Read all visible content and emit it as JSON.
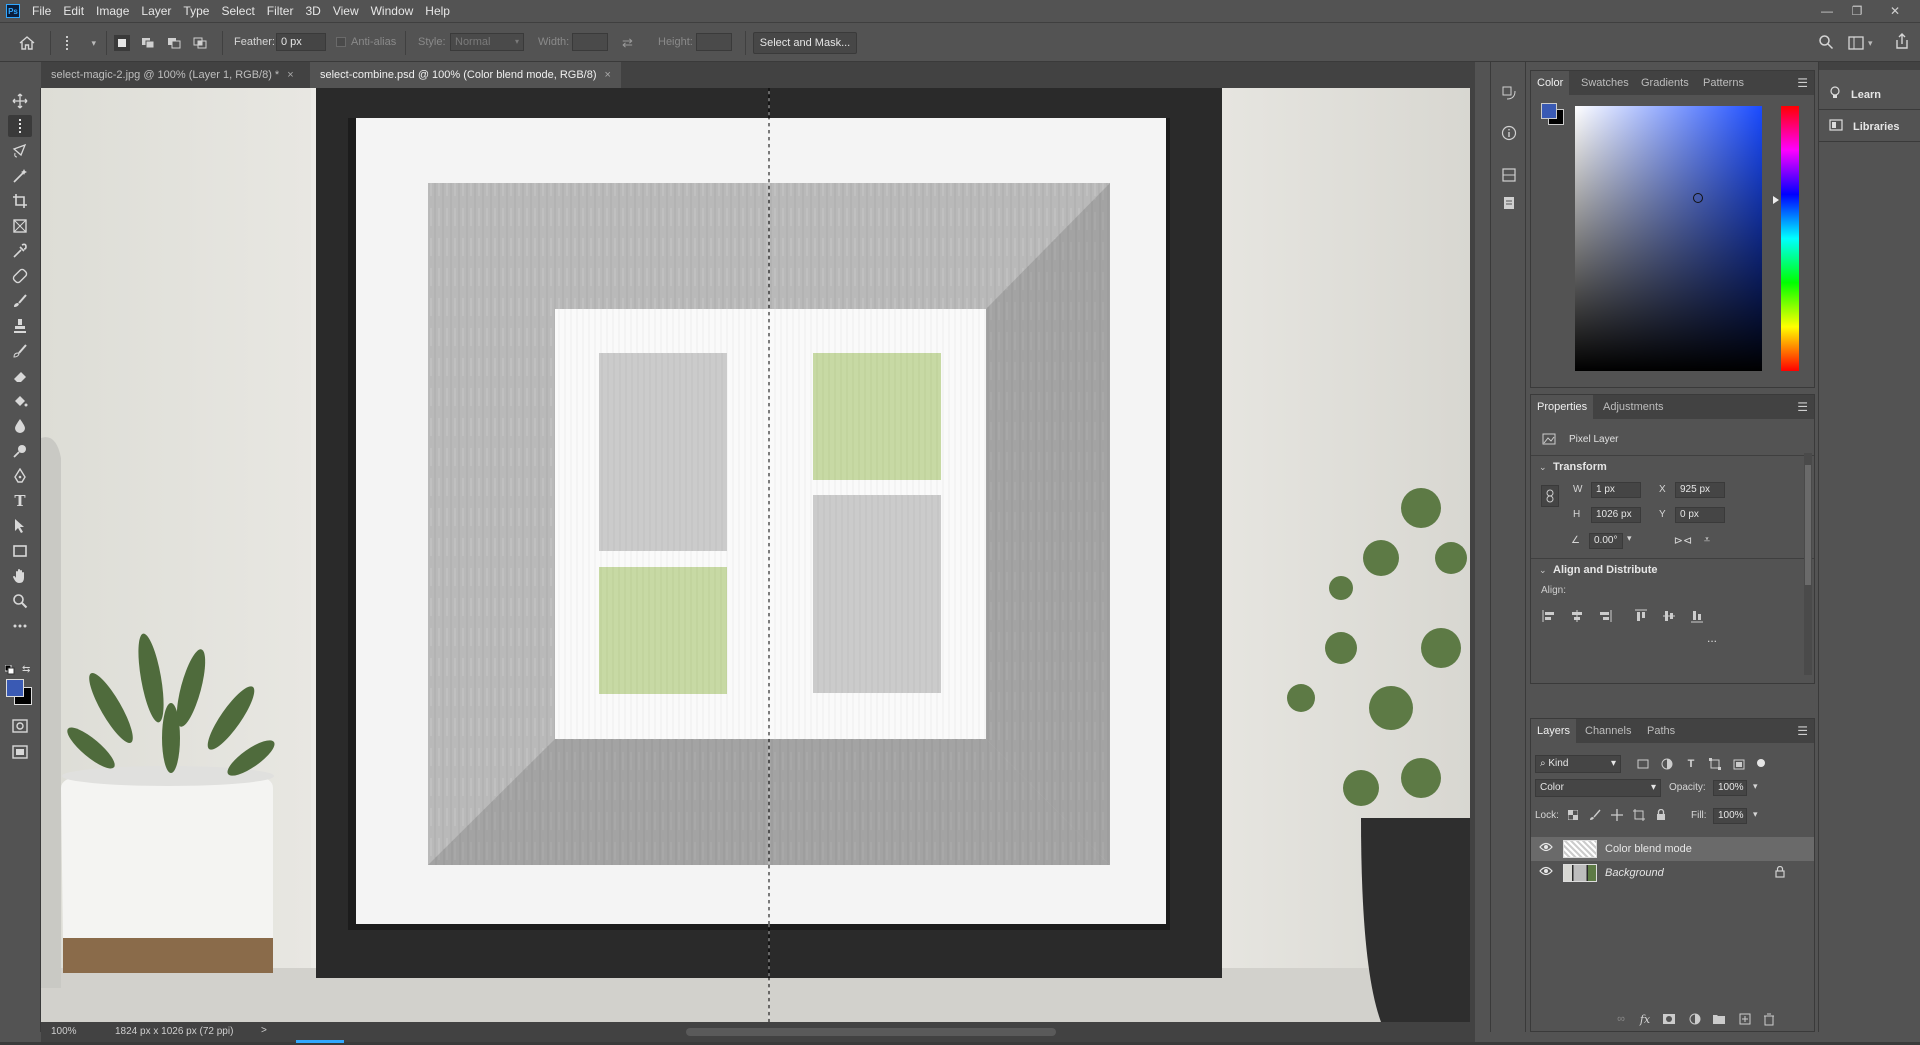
{
  "menubar": {
    "items": [
      "File",
      "Edit",
      "Image",
      "Layer",
      "Type",
      "Select",
      "Filter",
      "3D",
      "View",
      "Window",
      "Help"
    ],
    "app_icon_label": "Ps"
  },
  "options": {
    "feather_label": "Feather:",
    "feather_value": "0 px",
    "antialias_label": "Anti-alias",
    "style_label": "Style:",
    "style_value": "Normal",
    "width_label": "Width:",
    "height_label": "Height:",
    "select_mask_label": "Select and Mask..."
  },
  "tabs": [
    {
      "label": "select-magic-2.jpg @ 100% (Layer 1, RGB/8) *",
      "close": "×"
    },
    {
      "label": "select-combine.psd @ 100% (Color blend mode, RGB/8)",
      "close": "×"
    }
  ],
  "status": {
    "zoom": "100%",
    "doc_size": "1824 px x 1026 px (72 ppi)",
    "arrow": ">"
  },
  "color_panel": {
    "tabs": [
      "Color",
      "Swatches",
      "Gradients",
      "Patterns"
    ],
    "foreground": "#3a5ab4",
    "background": "#000000"
  },
  "properties_panel": {
    "tabs": [
      "Properties",
      "Adjustments"
    ],
    "layer_type": "Pixel Layer",
    "transform_title": "Transform",
    "w_label": "W",
    "w_value": "1 px",
    "x_label": "X",
    "x_value": "925 px",
    "h_label": "H",
    "h_value": "1026 px",
    "y_label": "Y",
    "y_value": "0 px",
    "angle_value": "0.00°",
    "align_title": "Align and Distribute",
    "align_label": "Align:",
    "more": "..."
  },
  "layers_panel": {
    "tabs": [
      "Layers",
      "Channels",
      "Paths"
    ],
    "kind_label": "Kind",
    "blend_mode": "Color",
    "opacity_label": "Opacity:",
    "opacity_value": "100%",
    "lock_label": "Lock:",
    "fill_label": "Fill:",
    "fill_value": "100%",
    "layers": [
      {
        "name": "Color blend mode"
      },
      {
        "name": "Background"
      }
    ]
  },
  "learn_panel": {
    "items": [
      "Learn",
      "Libraries"
    ]
  },
  "icons": [
    "home-icon",
    "marquee-tool-icon",
    "move-tool-icon",
    "lasso-tool-icon",
    "crop-tool-icon",
    "eyedropper-tool-icon",
    "brush-tool-icon",
    "eraser-tool-icon",
    "pen-tool-icon",
    "type-tool-icon",
    "hand-tool-icon",
    "zoom-tool-icon",
    "search-icon",
    "eye-icon",
    "lock-icon",
    "trash-icon"
  ],
  "colors": {
    "accent": "#31a8ff",
    "panel": "#535353",
    "dark": "#424242"
  }
}
